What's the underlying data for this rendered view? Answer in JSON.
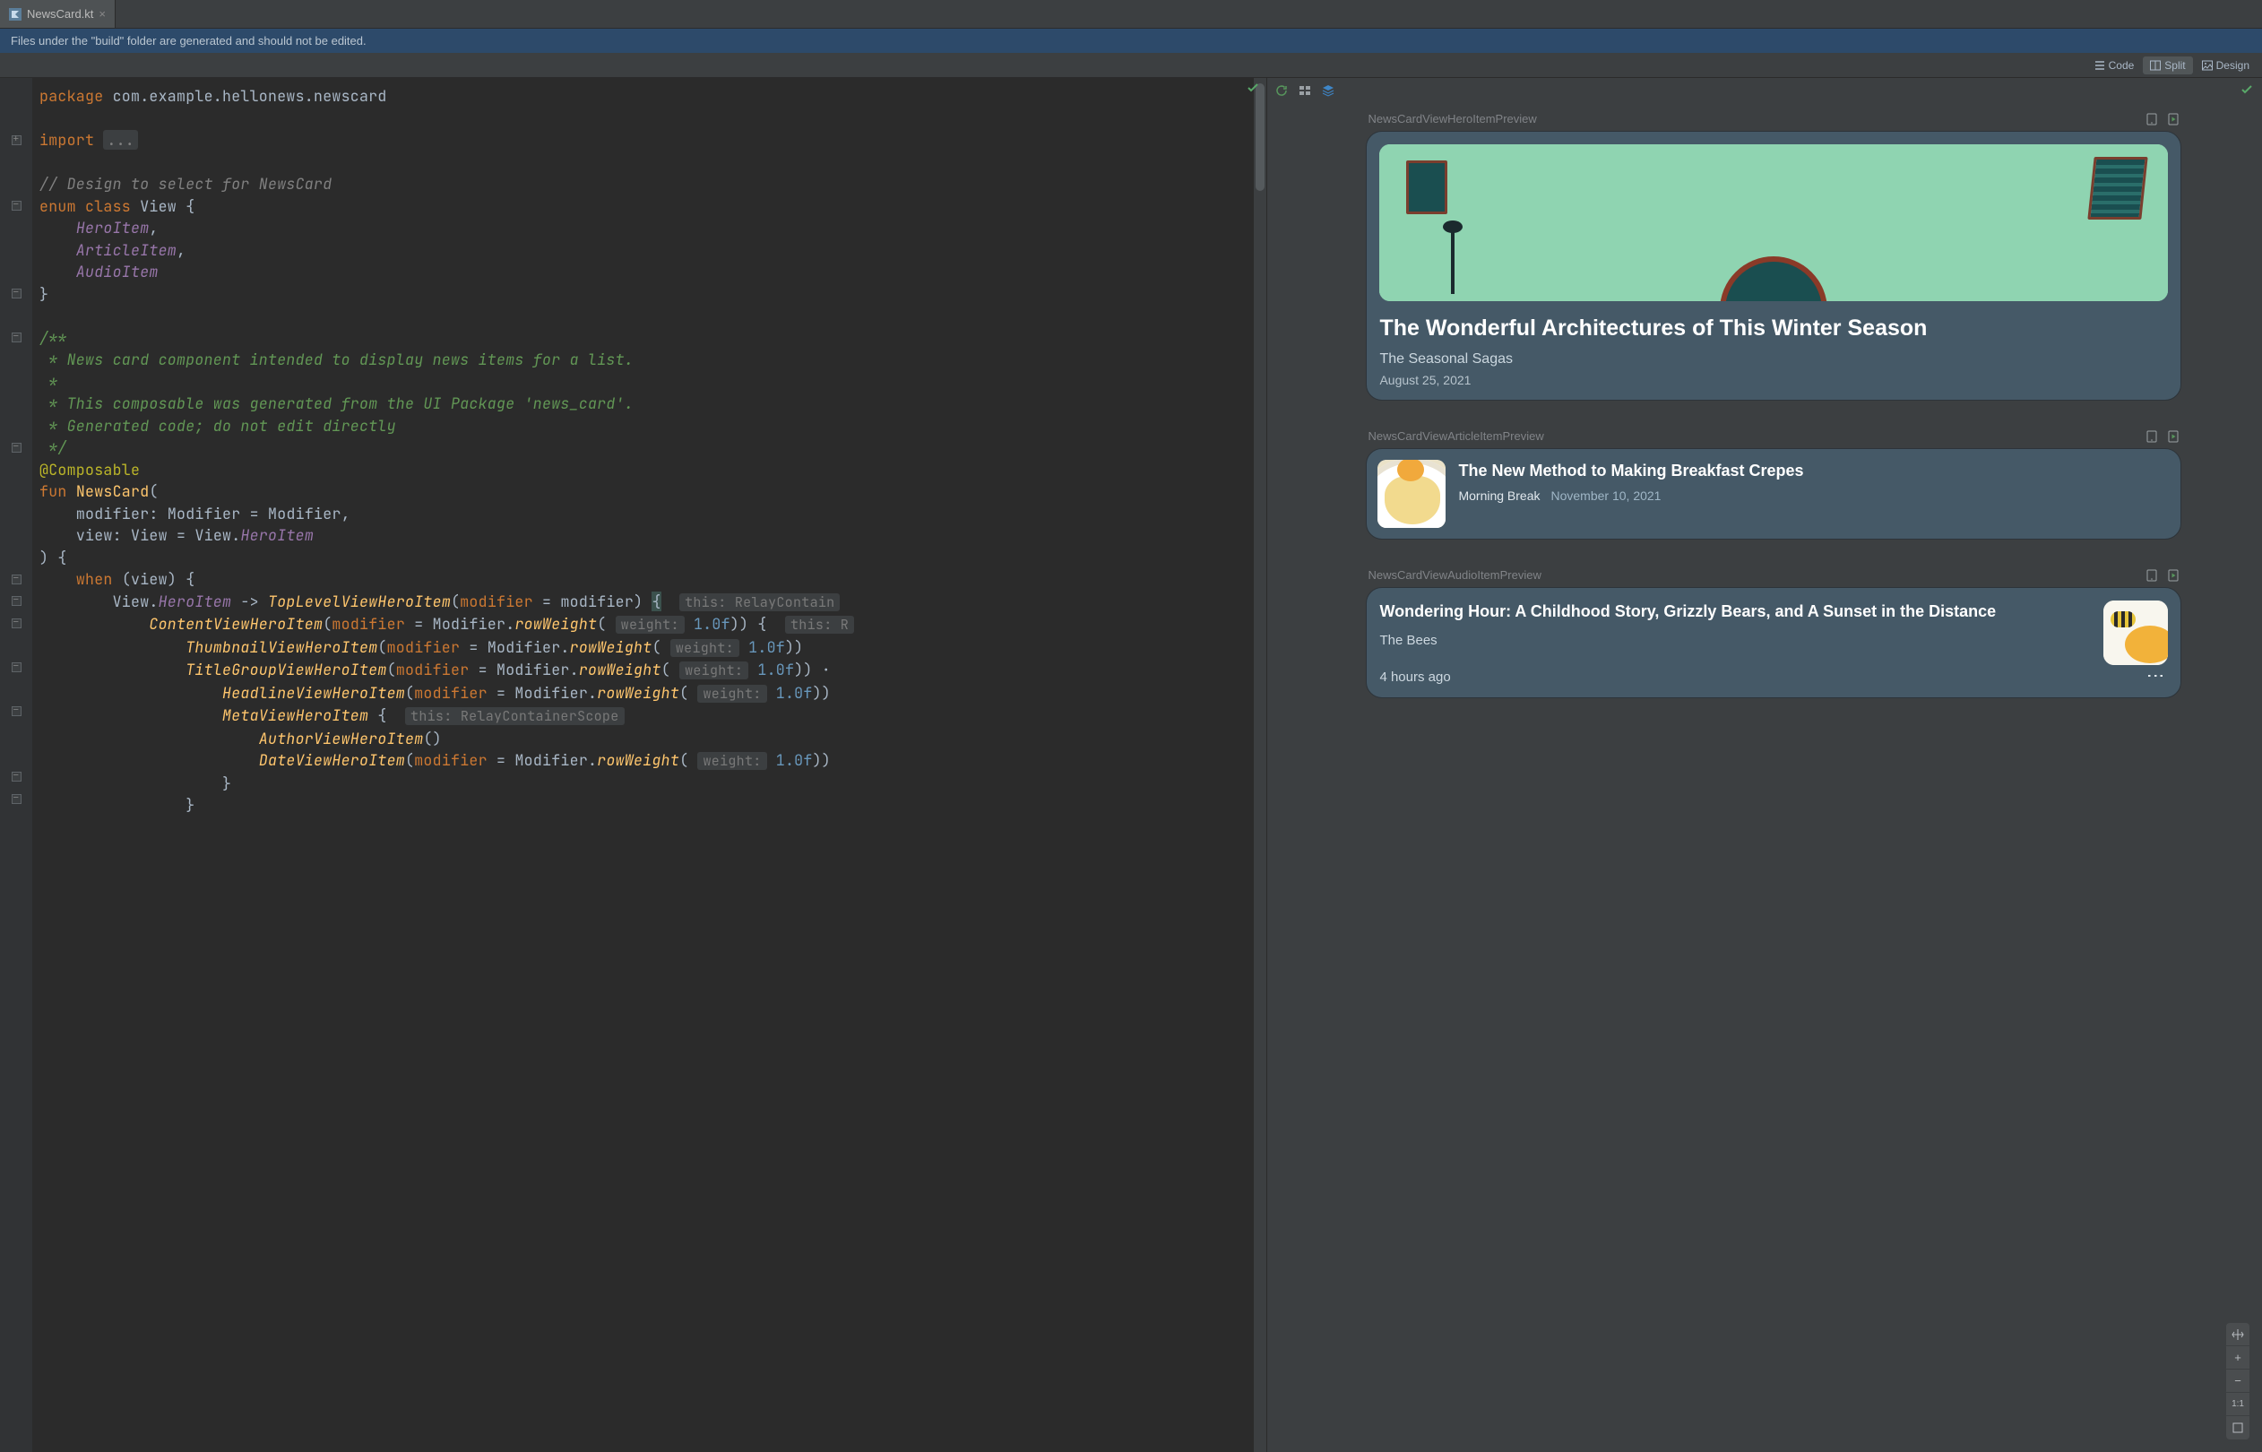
{
  "tab": {
    "filename": "NewsCard.kt"
  },
  "notice": "Files under the \"build\" folder are generated and should not be edited.",
  "viewmodes": {
    "code": "Code",
    "split": "Split",
    "design": "Design",
    "active": "split"
  },
  "code": {
    "package_kw": "package",
    "package_path": "com.example.hellonews.newscard",
    "import_kw": "import",
    "import_fold": "...",
    "cmt_design": "// Design to select for NewsCard",
    "enum_decl": "enum class",
    "enum_name": "View",
    "enum_items": [
      "HeroItem",
      "ArticleItem",
      "AudioItem"
    ],
    "doc1": "/**",
    "doc2": " * News card component intended to display news items for a list.",
    "doc3": " *",
    "doc4": " * This composable was generated from the UI Package 'news_card'.",
    "doc5": " * Generated code; do not edit directly",
    "doc6": " */",
    "ann": "@Composable",
    "fun_kw": "fun",
    "fun_name": "NewsCard",
    "p_modifier": "modifier",
    "t_modifier": "Modifier",
    "eq_modifier": "Modifier",
    "p_view": "view",
    "t_view": "View",
    "eq_view_pref": "View.",
    "eq_view_val": "HeroItem",
    "when_kw": "when",
    "when_arg": "view",
    "arrow": "->",
    "call_toplevel": "TopLevelViewHeroItem",
    "call_content": "ContentViewHeroItem",
    "call_thumb": "ThumbnailViewHeroItem",
    "call_titlegrp": "TitleGroupViewHeroItem",
    "call_headline": "HeadlineViewHeroItem",
    "call_meta": "MetaViewHeroItem",
    "call_author": "AuthorViewHeroItem",
    "call_date": "DateViewHeroItem",
    "mod_named": "modifier",
    "mod_row": "Modifier.",
    "mod_rowfn": "rowWeight",
    "hint_weight": "weight:",
    "val_1f": "1.0f",
    "hint_this_rc": "this: RelayContain",
    "hint_this_r": "this: R",
    "hint_this_rcs": "this: RelayContainerScope",
    "view_pref": "View.",
    "view_hero": "HeroItem"
  },
  "previews": {
    "hero": {
      "label": "NewsCardViewHeroItemPreview",
      "headline": "The Wonderful Architectures of This Winter Season",
      "author": "The Seasonal Sagas",
      "date": "August 25, 2021"
    },
    "article": {
      "label": "NewsCardViewArticleItemPreview",
      "headline": "The New Method to Making Breakfast Crepes",
      "author": "Morning Break",
      "date": "November 10, 2021"
    },
    "audio": {
      "label": "NewsCardViewAudioItemPreview",
      "headline": "Wondering Hour: A Childhood Story, Grizzly Bears, and A Sunset in the Distance",
      "author": "The Bees",
      "time": "4 hours ago"
    }
  },
  "zoom": {
    "ratio": "1:1"
  }
}
